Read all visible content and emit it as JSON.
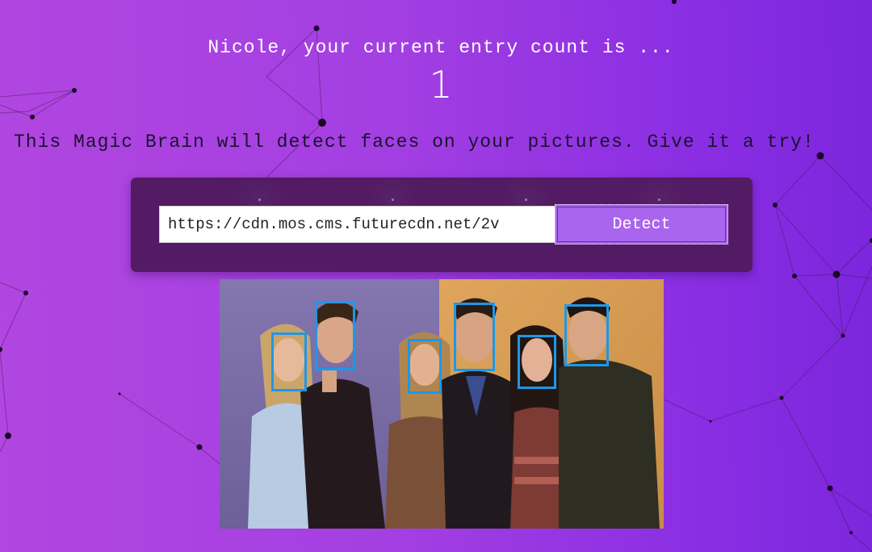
{
  "greeting": {
    "text": "Nicole, your current entry count is ...",
    "count": "1"
  },
  "tagline": "This Magic Brain will detect faces on your pictures. Give it a try!",
  "form": {
    "url_value": "https://cdn.mos.cms.futurecdn.net/2v",
    "detect_label": "Detect"
  },
  "image": {
    "face_count": 6
  },
  "colors": {
    "background_start": "#b146e0",
    "background_end": "#7b26dd",
    "panel": "#521b63",
    "button": "#a965ee",
    "face_box": "#1f97e6"
  }
}
